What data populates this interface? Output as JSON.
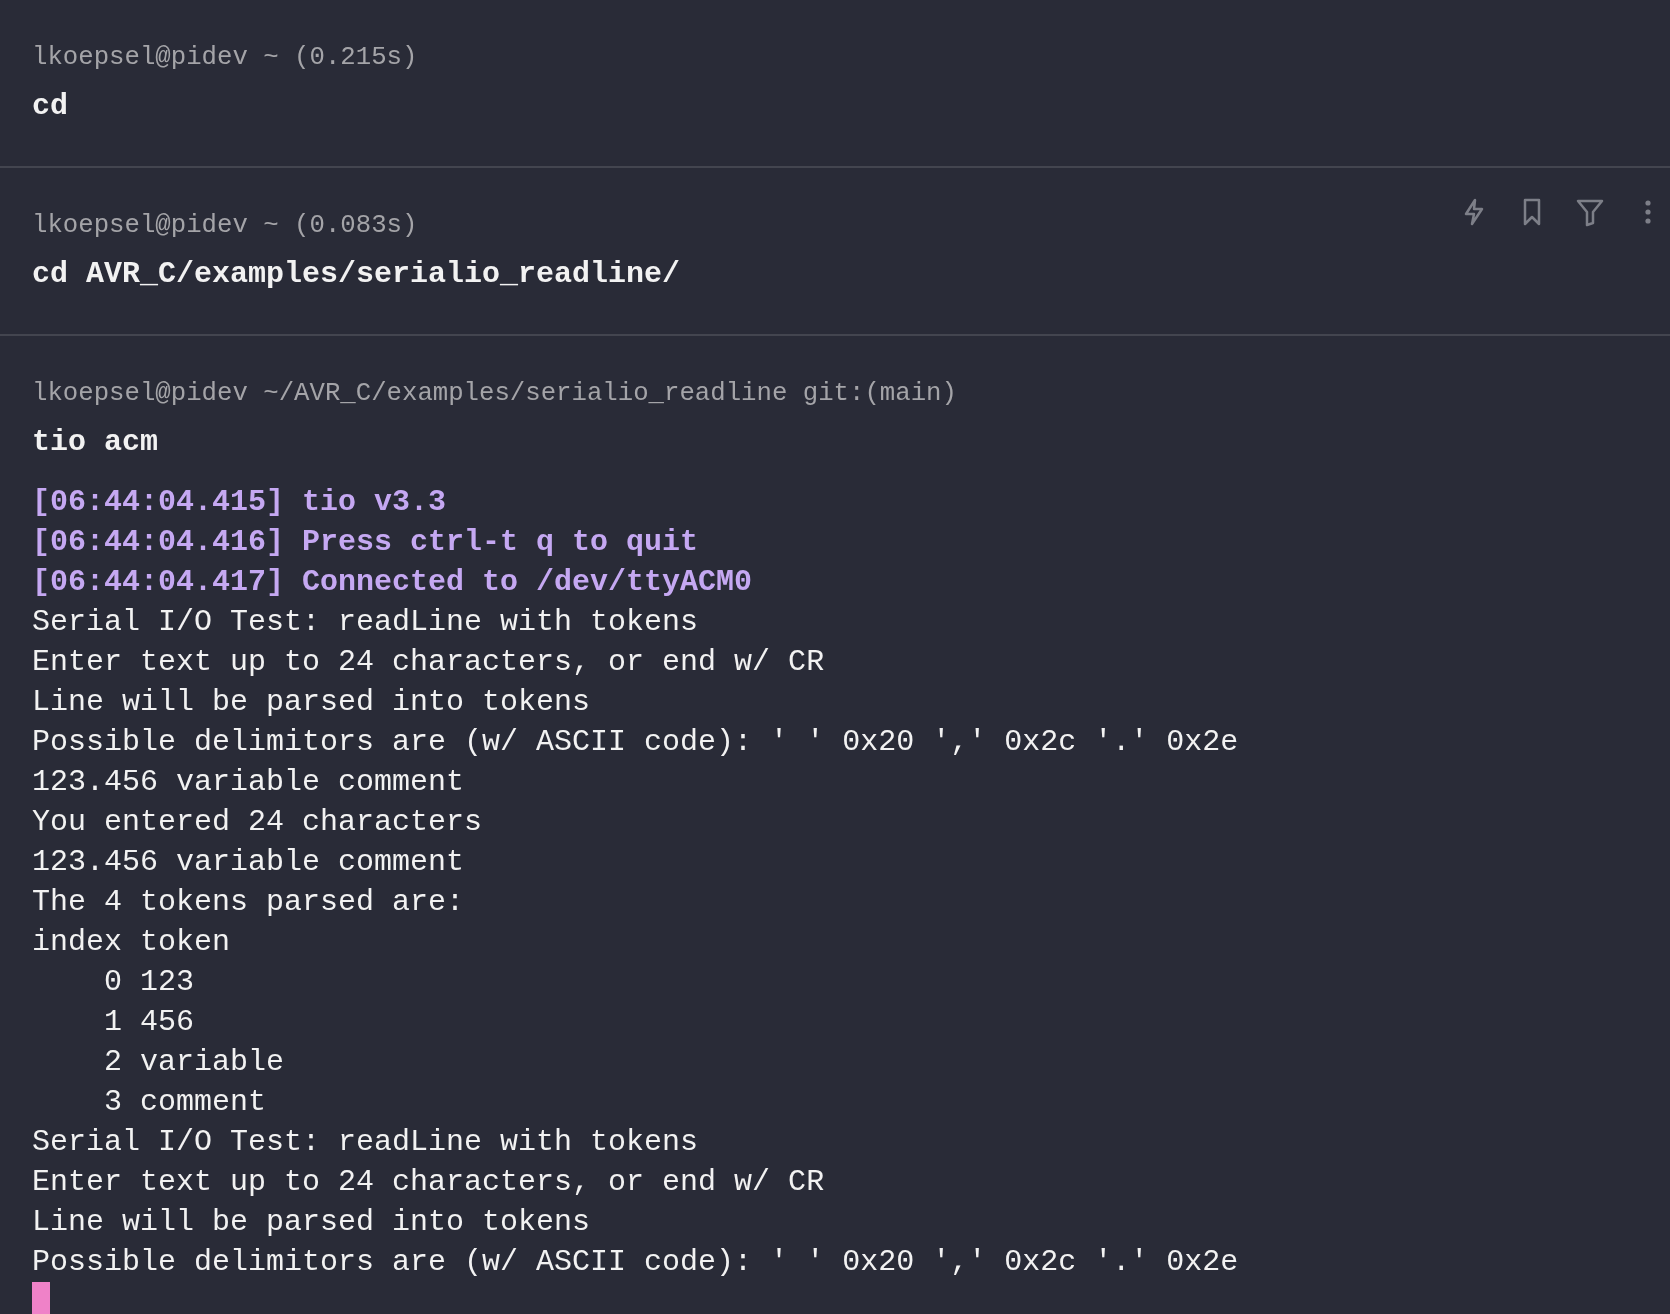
{
  "blocks": [
    {
      "prompt": "lkoepsel@pidev ~ (0.215s)",
      "command": "cd",
      "hovered": false
    },
    {
      "prompt": "lkoepsel@pidev ~ (0.083s)",
      "command": "cd AVR_C/examples/serialio_readline/",
      "hovered": true
    },
    {
      "prompt": "lkoepsel@pidev ~/AVR_C/examples/serialio_readline git:(main)",
      "command": "tio acm",
      "hovered": false,
      "cursor": true,
      "output": [
        {
          "kind": "system",
          "text": "[06:44:04.415] tio v3.3"
        },
        {
          "kind": "system",
          "text": "[06:44:04.416] Press ctrl-t q to quit"
        },
        {
          "kind": "system",
          "text": "[06:44:04.417] Connected to /dev/ttyACM0"
        },
        {
          "kind": "plain",
          "text": "Serial I/O Test: readLine with tokens"
        },
        {
          "kind": "plain",
          "text": "Enter text up to 24 characters, or end w/ CR"
        },
        {
          "kind": "plain",
          "text": "Line will be parsed into tokens"
        },
        {
          "kind": "plain",
          "text": "Possible delimitors are (w/ ASCII code): ' ' 0x20 ',' 0x2c '.' 0x2e"
        },
        {
          "kind": "plain",
          "text": "123.456 variable comment"
        },
        {
          "kind": "plain",
          "text": "You entered 24 characters"
        },
        {
          "kind": "plain",
          "text": "123.456 variable comment"
        },
        {
          "kind": "plain",
          "text": "The 4 tokens parsed are:"
        },
        {
          "kind": "plain",
          "text": "index token"
        },
        {
          "kind": "plain",
          "text": "    0 123"
        },
        {
          "kind": "plain",
          "text": "    1 456"
        },
        {
          "kind": "plain",
          "text": "    2 variable"
        },
        {
          "kind": "plain",
          "text": "    3 comment"
        },
        {
          "kind": "plain",
          "text": "Serial I/O Test: readLine with tokens"
        },
        {
          "kind": "plain",
          "text": "Enter text up to 24 characters, or end w/ CR"
        },
        {
          "kind": "plain",
          "text": "Line will be parsed into tokens"
        },
        {
          "kind": "plain",
          "text": "Possible delimitors are (w/ ASCII code): ' ' 0x20 ',' 0x2c '.' 0x2e"
        }
      ]
    }
  ]
}
